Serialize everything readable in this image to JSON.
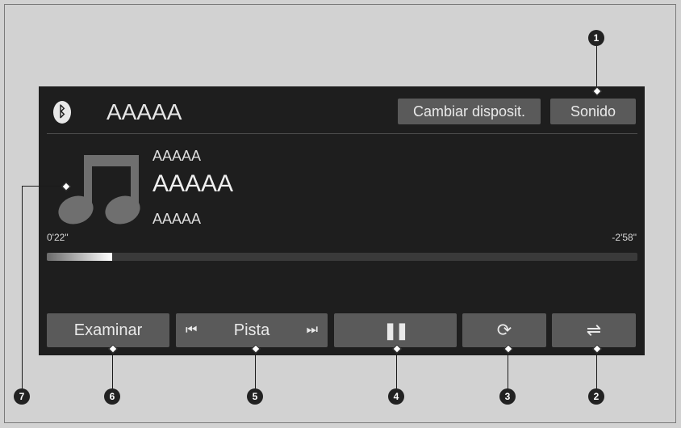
{
  "header": {
    "bluetooth_glyph": "ᛒ",
    "source_label": "AAAAA",
    "change_device_label": "Cambiar disposit.",
    "sound_label": "Sonido"
  },
  "track": {
    "artist": "AAAAA",
    "title": "AAAAA",
    "album": "AAAAA"
  },
  "progress": {
    "elapsed": "0'22\"",
    "remaining": "-2'58\"",
    "fraction": 0.11
  },
  "controls": {
    "browse_label": "Examinar",
    "track_label": "Pista",
    "prev_glyph": "⏮",
    "next_glyph": "⏭",
    "pause_glyph": "❚❚",
    "repeat_glyph": "⟳",
    "shuffle_glyph": "⇌"
  },
  "callouts": [
    "1",
    "2",
    "3",
    "4",
    "5",
    "6",
    "7"
  ],
  "colors": {
    "background": "#d2d2d2",
    "screen": "#1e1e1e",
    "button": "#5a5a5a",
    "text": "#e9e9e9"
  },
  "icons": [
    "bluetooth-icon",
    "music-note-icon",
    "previous-track-icon",
    "next-track-icon",
    "pause-icon",
    "repeat-icon",
    "shuffle-icon"
  ]
}
